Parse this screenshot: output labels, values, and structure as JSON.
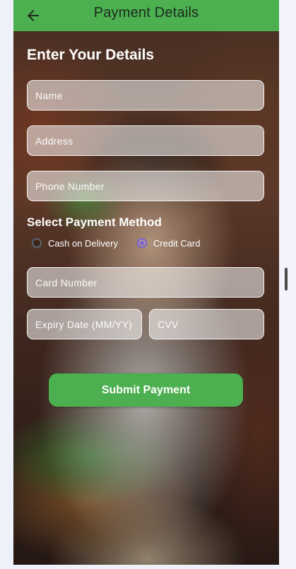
{
  "appbar": {
    "title": "Payment Details",
    "back_icon": "arrow-left-icon",
    "color": "#4caf50"
  },
  "form": {
    "heading": "Enter Your Details",
    "name_placeholder": "Name",
    "address_placeholder": "Address",
    "phone_placeholder": "Phone Number",
    "payment_method_label": "Select Payment Method",
    "payment_options": [
      {
        "label": "Cash on Delivery",
        "selected": false
      },
      {
        "label": "Credit Card",
        "selected": true
      }
    ],
    "card_number_placeholder": "Card Number",
    "expiry_placeholder": "Expiry Date (MM/YY)",
    "cvv_placeholder": "CVV",
    "submit_label": "Submit Payment",
    "radio_accent": "#7b61d6"
  }
}
